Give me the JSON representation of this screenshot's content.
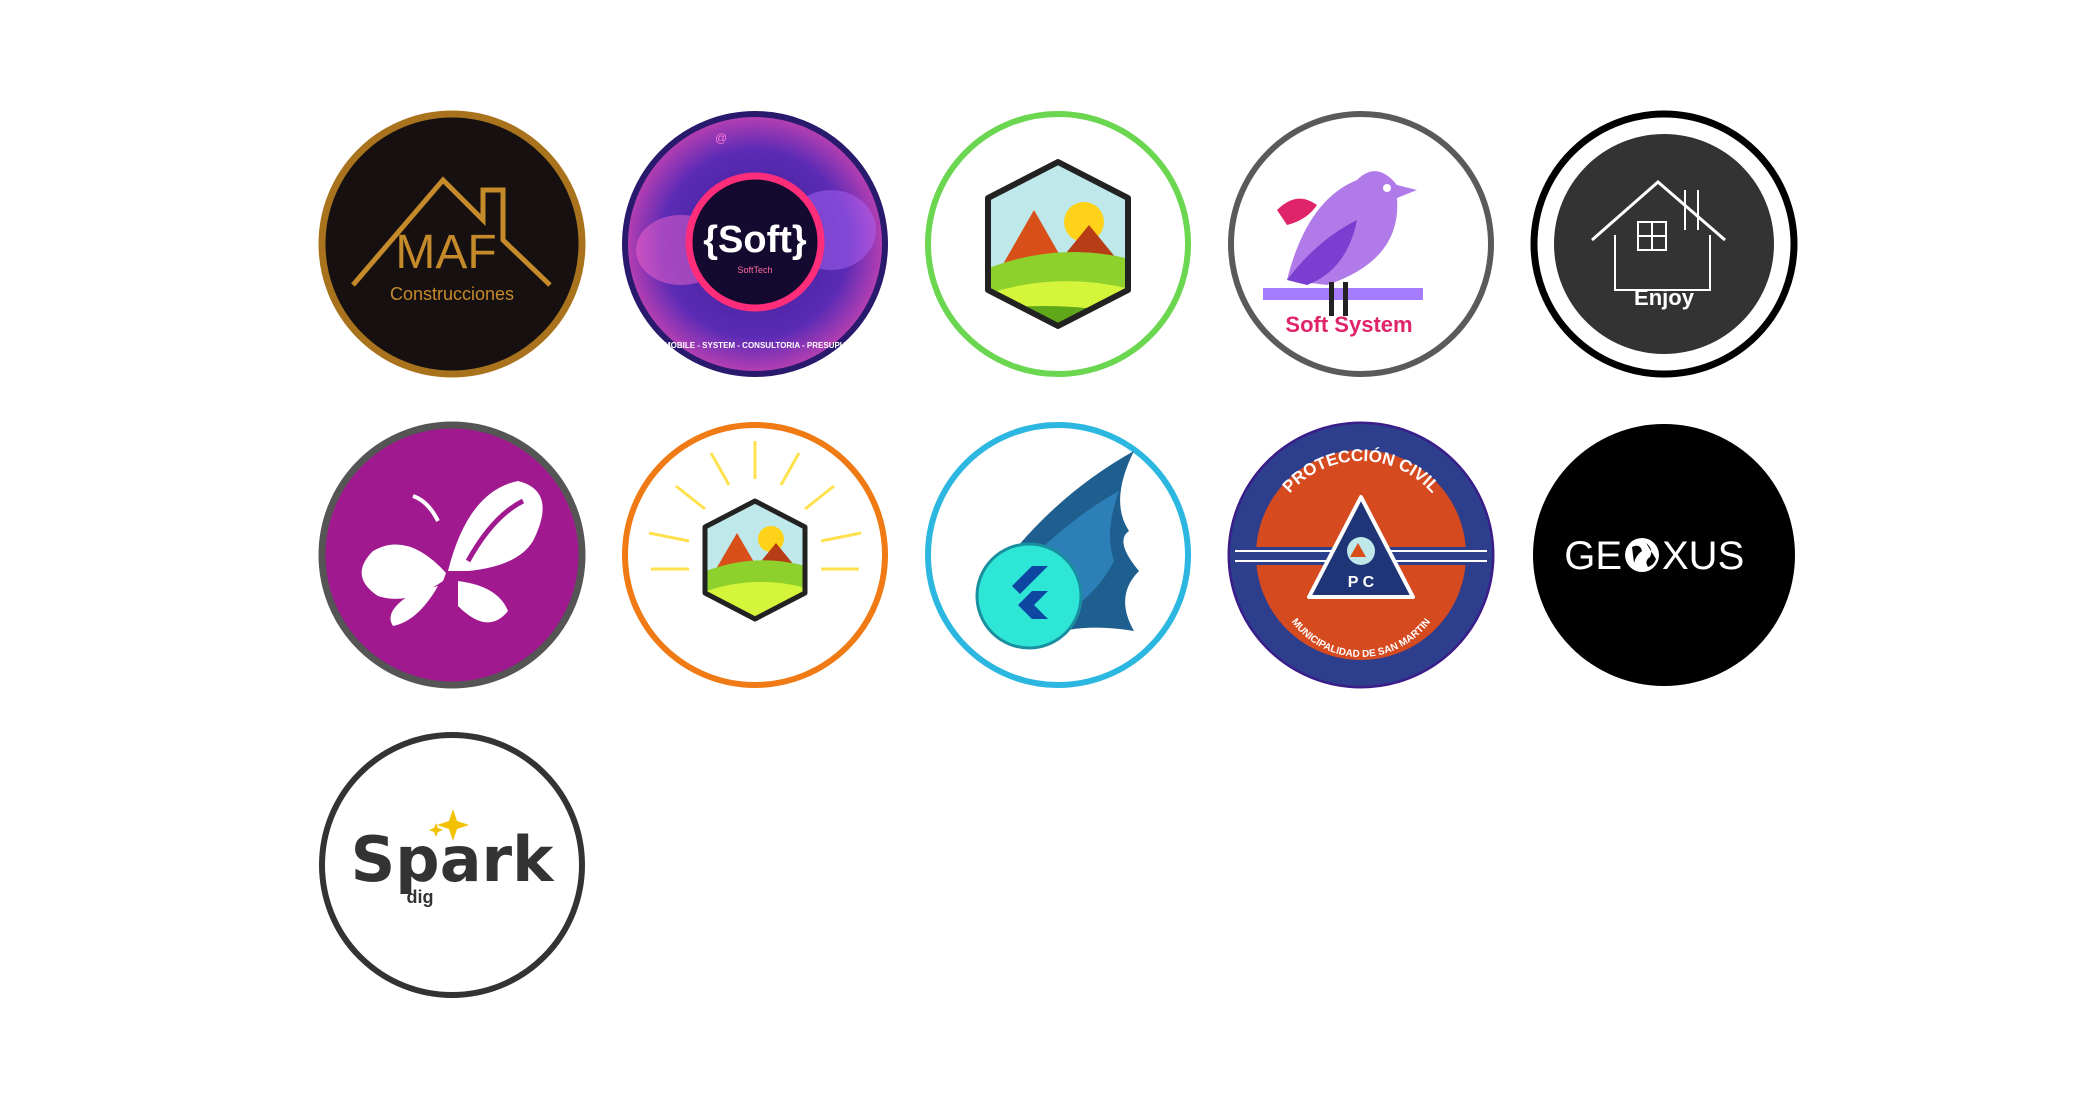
{
  "logos": [
    {
      "id": "maf",
      "title": "MAF",
      "subtitle": "Construcciones",
      "ring": "#a8731c",
      "bg": "#161010",
      "accent": "#c58a2a"
    },
    {
      "id": "softtech",
      "title": "{Soft}",
      "subtitle": "SoftTech",
      "footer": "- MOBILE - SYSTEM - CONSULTORIA - PRESUPUE",
      "ring": "#2a1a6e",
      "bg": "#1a0f45",
      "accent": "#ff2d7a"
    },
    {
      "id": "hexagon-landscape",
      "ring": "#6bd64f",
      "bg": "#ffffff"
    },
    {
      "id": "soft-system",
      "title": "Soft System",
      "ring": "#5a5a5a",
      "bg": "#ffffff",
      "accent": "#b07be8"
    },
    {
      "id": "enjoy",
      "title": "Enjoy",
      "ring": "#000000",
      "bg": "#333333"
    },
    {
      "id": "butterfly",
      "ring": "#555555",
      "bg": "#a0198f"
    },
    {
      "id": "sun-hexagon",
      "ring": "#f07a14",
      "bg": "#ffffff",
      "accent": "#ffe14d"
    },
    {
      "id": "flutter-comet",
      "ring": "#2bb7e0",
      "bg": "#ffffff",
      "accent": "#2ee6d6"
    },
    {
      "id": "proteccion-civil",
      "title": "PROTECCIÓN CIVIL",
      "subtitle": "MUNICIPALIDAD DE SAN MARTIN",
      "badge": "P C",
      "ring": "#3b1d8a",
      "bg": "#2c3e8c",
      "accent": "#d64a1f"
    },
    {
      "id": "geoxus",
      "title": "GE",
      "title_end": "XUS",
      "ring": "#000000",
      "bg": "#000000"
    },
    {
      "id": "spark",
      "title": "Spark",
      "subtitle": "dig",
      "ring": "#333333",
      "bg": "#ffffff",
      "accent": "#f2c200"
    }
  ]
}
